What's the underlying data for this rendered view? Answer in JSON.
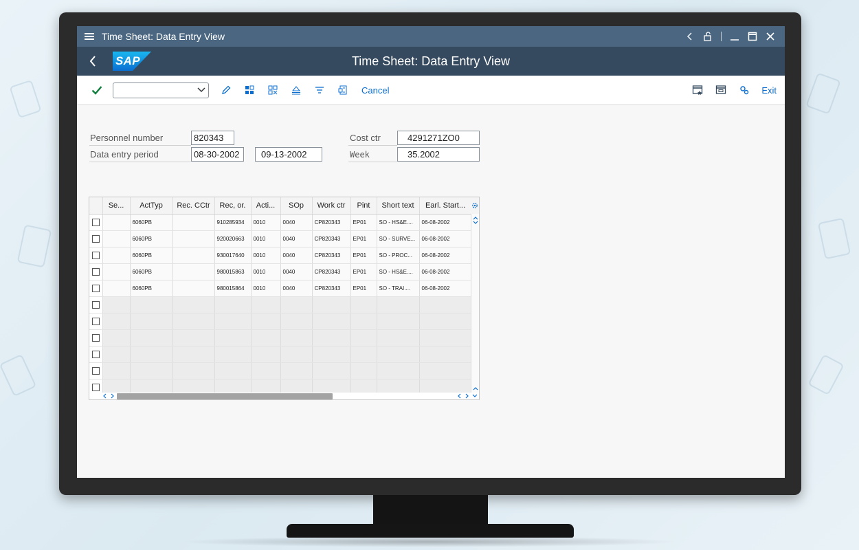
{
  "window": {
    "title": "Time Sheet: Data Entry View"
  },
  "shell": {
    "logo_text": "SAP",
    "title": "Time Sheet: Data Entry View"
  },
  "toolbar": {
    "combo_value": "",
    "cancel_label": "Cancel",
    "exit_label": "Exit",
    "accent": "#0a6ed1",
    "check_color": "#107e3e"
  },
  "form": {
    "personnel_number": {
      "label": "Personnel number",
      "value": "820343"
    },
    "cost_ctr": {
      "label": "Cost ctr",
      "value": "4291271ZO0"
    },
    "data_entry_period": {
      "label": "Data entry period",
      "from": "08-30-2002",
      "to": "09-13-2002"
    },
    "week": {
      "label": "Week",
      "value": "35.2002"
    }
  },
  "table": {
    "columns": [
      "Se...",
      "ActTyp",
      "Rec. CCtr",
      "Rec, or.",
      "Acti...",
      "SOp",
      "Work ctr",
      "Pint",
      "Short text",
      "Earl. Start..."
    ],
    "rows": [
      [
        "",
        "6060PB",
        "",
        "910285934",
        "0010",
        "0040",
        "CP820343",
        "EP01",
        "SO - HS&E....",
        "06-08-2002"
      ],
      [
        "",
        "6060PB",
        "",
        "920020663",
        "0010",
        "0040",
        "CP820343",
        "EP01",
        "SO - SURVE...",
        "06-08-2002"
      ],
      [
        "",
        "6060PB",
        "",
        "930017640",
        "0010",
        "0040",
        "CP820343",
        "EP01",
        "SO - PROC...",
        "06-08-2002"
      ],
      [
        "",
        "6060PB",
        "",
        "980015863",
        "0010",
        "0040",
        "CP820343",
        "EP01",
        "SO - HS&E....",
        "06-08-2002"
      ],
      [
        "",
        "6060PB",
        "",
        "980015864",
        "0010",
        "0040",
        "CP820343",
        "EP01",
        "SO - TRAI....",
        "06-08-2002"
      ]
    ],
    "empty_rows": 6
  },
  "colors": {
    "titlebar": "#4a6680",
    "shellbar": "#354a5f",
    "screen_bg": "#f7f7f7"
  }
}
